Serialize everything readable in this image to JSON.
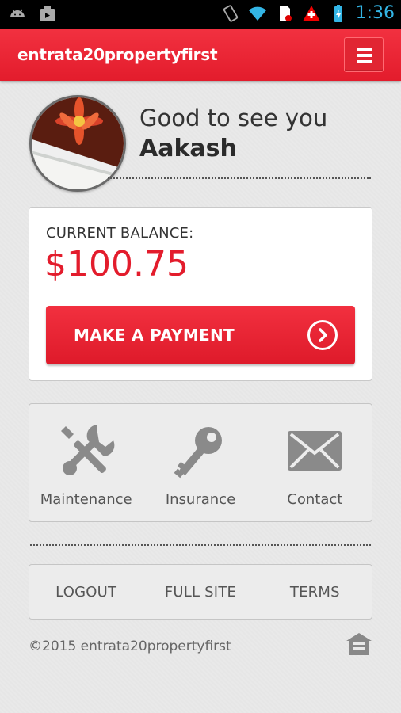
{
  "status_bar": {
    "left_icons": [
      "android-icon",
      "photo-icon"
    ],
    "right_icons": [
      "vibrate-icon",
      "wifi-icon",
      "sim-icon",
      "alert-icon",
      "battery-icon"
    ],
    "time": "1:36"
  },
  "app_bar": {
    "title": "entrata20propertyfirst",
    "menu_icon": "hamburger-icon"
  },
  "profile": {
    "greeting": "Good to see you",
    "name": "Aakash"
  },
  "balance": {
    "label": "CURRENT BALANCE:",
    "amount": "$100.75",
    "pay_button": "MAKE A PAYMENT"
  },
  "tiles": [
    {
      "label": "Maintenance",
      "icon": "wrench-screwdriver-icon"
    },
    {
      "label": "Insurance",
      "icon": "key-icon"
    },
    {
      "label": "Contact",
      "icon": "envelope-icon"
    }
  ],
  "links": [
    {
      "label": "LOGOUT"
    },
    {
      "label": "FULL SITE"
    },
    {
      "label": "TERMS"
    }
  ],
  "footer": {
    "copyright": "©2015 entrata20propertyfirst",
    "badge_icon": "equal-housing-icon"
  },
  "colors": {
    "accent": "#e31c2c",
    "clock": "#33b5e5"
  }
}
